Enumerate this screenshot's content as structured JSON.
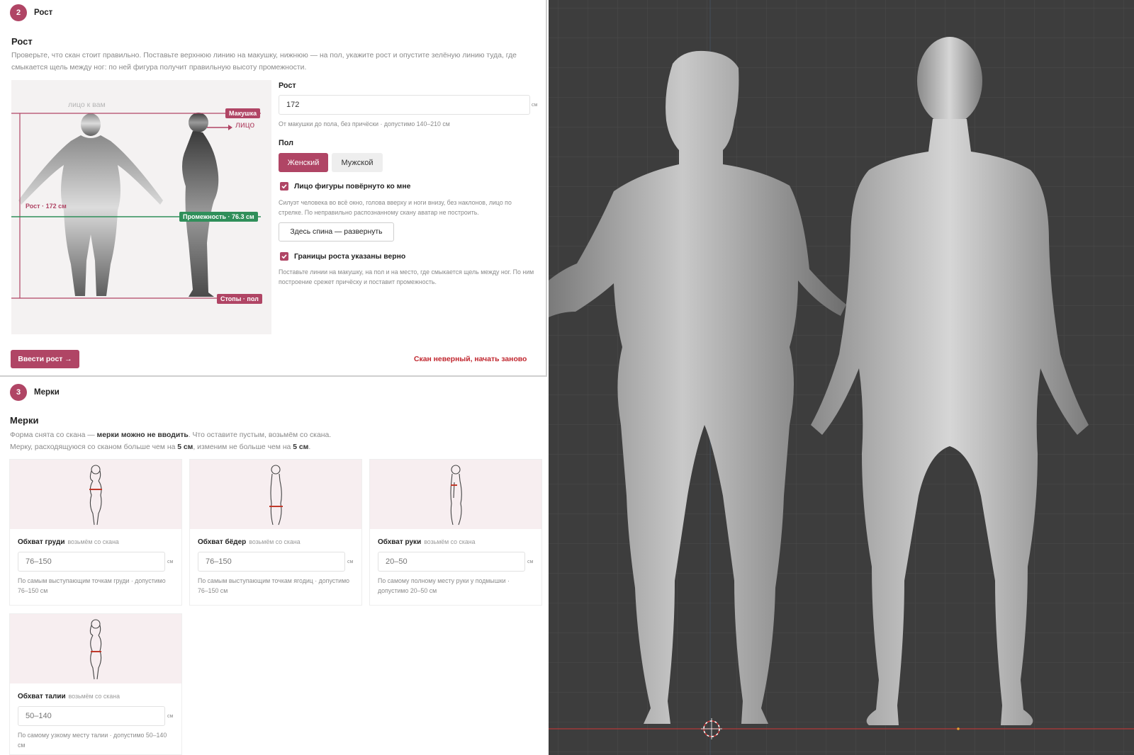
{
  "step2": {
    "number": "2",
    "header": "Рост",
    "title": "Рост",
    "description": "Проверьте, что скан стоит правильно. Поставьте верхнюю линию на макушку, нижнюю — на пол, укажите рост и опустите зелёную линию туда, где смыкается щель между ног: по ней фигура получит правильную высоту промежности.",
    "diagram": {
      "face_to_you": "лицо к вам",
      "top_marker": "Макушка",
      "face_marker": "лицо",
      "height_marker": "Рост · 172 см",
      "crotch_marker": "Промежность · 76.3 см",
      "floor_marker": "Стопы · пол"
    },
    "height_label": "Рост",
    "height_value": "172",
    "height_unit": "см",
    "height_hint": "От макушки до пола, без причёски · допустимо 140–210 см",
    "sex_label": "Пол",
    "sex_female": "Женский",
    "sex_male": "Мужской",
    "face_check_label": "Лицо фигуры повёрнуто ко мне",
    "face_check_hint": "Силуэт человека во всё окно, голова вверху и ноги внизу, без наклонов, лицо по стрелке. По неправильно распознанному скану аватар не построить.",
    "back_button": "Здесь спина — развернуть",
    "bounds_check_label": "Границы роста указаны верно",
    "bounds_check_hint": "Поставьте линии на макушку, на пол и на место, где смыкается щель между ног. По ним построение срежет причёску и поставит промежность.",
    "submit_button": "Ввести рост →",
    "restart_link": "Скан неверный, начать заново"
  },
  "step3": {
    "number": "3",
    "header": "Мерки",
    "title": "Мерки",
    "desc_line1_a": "Форма снята со скана — ",
    "desc_line1_b": "мерки можно не вводить",
    "desc_line1_c": ". Что оставите пустым, возьмём со скана.",
    "desc_line2_a": "Мерку, расходящуюся со сканом больше чем на ",
    "desc_line2_b": "5 см",
    "desc_line2_c": ", изменим не больше чем на ",
    "desc_line2_d": "5 см",
    "desc_line2_e": ".",
    "from_scan": "возьмём со скана",
    "unit": "см",
    "cards": [
      {
        "name": "Обхват груди",
        "placeholder": "76–150",
        "hint": "По самым выступающим точкам груди · допустимо 76–150 см"
      },
      {
        "name": "Обхват бёдер",
        "placeholder": "76–150",
        "hint": "По самым выступающим точкам ягодиц · допустимо 76–150 см"
      },
      {
        "name": "Обхват руки",
        "placeholder": "20–50",
        "hint": "По самому полному месту руки у подмышки · допустимо 20–50 см"
      },
      {
        "name": "Обхват талии",
        "placeholder": "50–140",
        "hint": "По самому узкому месту талии · допустимо 50–140 см"
      }
    ]
  },
  "colors": {
    "accent": "#b04565",
    "crotch_line": "#2f8f5a",
    "restart_link": "#c0262e",
    "viewport_bg": "#3d3d3d",
    "grid": "#4a4a4a",
    "floor_line": "#b33a3a"
  },
  "icons": [
    "check-icon",
    "figure-chest-icon",
    "figure-hips-icon",
    "figure-arm-icon",
    "figure-waist-icon",
    "origin-cursor-icon"
  ]
}
